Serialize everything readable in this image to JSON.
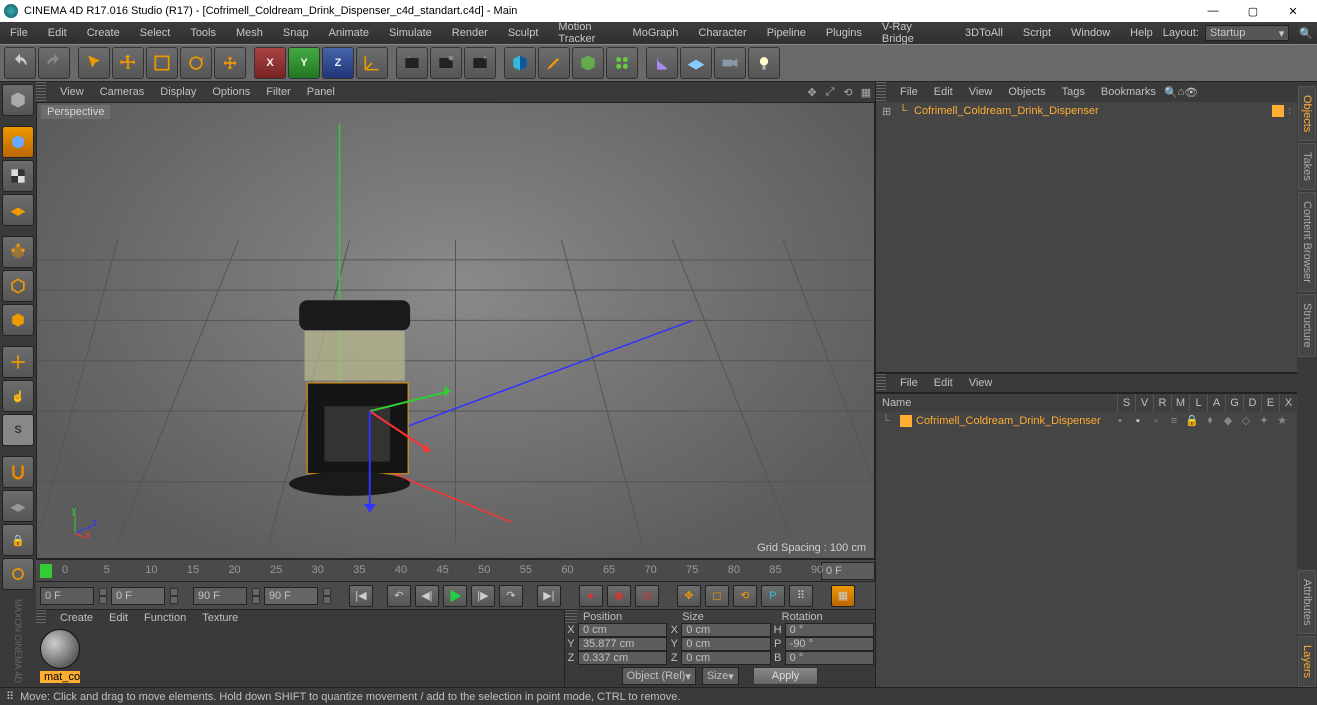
{
  "title": "CINEMA 4D R17.016 Studio (R17) - [Cofrimell_Coldream_Drink_Dispenser_c4d_standart.c4d] - Main",
  "menu": [
    "File",
    "Edit",
    "Create",
    "Select",
    "Tools",
    "Mesh",
    "Snap",
    "Animate",
    "Simulate",
    "Render",
    "Sculpt",
    "Motion Tracker",
    "MoGraph",
    "Character",
    "Pipeline",
    "Plugins",
    "V-Ray Bridge",
    "3DToAll",
    "Script",
    "Window",
    "Help"
  ],
  "layout_label": "Layout:",
  "layout_value": "Startup",
  "viewmenu": [
    "View",
    "Cameras",
    "Display",
    "Options",
    "Filter",
    "Panel"
  ],
  "perspective": "Perspective",
  "grid_spacing": "Grid Spacing : 100 cm",
  "timeline_numbers": [
    "0",
    "5",
    "10",
    "15",
    "20",
    "25",
    "30",
    "35",
    "40",
    "45",
    "50",
    "55",
    "60",
    "65",
    "70",
    "75",
    "80",
    "85",
    "90"
  ],
  "timeline_end": "0 F",
  "play_start": "0 F",
  "play_cur": "0 F",
  "play_end": "90 F",
  "play_end2": "90 F",
  "material_menu": [
    "Create",
    "Edit",
    "Function",
    "Texture"
  ],
  "material_name": "mat_col",
  "coord_hdr": [
    "Position",
    "Size",
    "Rotation"
  ],
  "coord": {
    "x": {
      "pos": "0 cm",
      "size": "0 cm",
      "rot": "0 °",
      "r": "H"
    },
    "y": {
      "pos": "35.877 cm",
      "size": "0 cm",
      "rot": "-90 °",
      "r": "P"
    },
    "z": {
      "pos": "0.337 cm",
      "size": "0 cm",
      "rot": "0 °",
      "r": "B"
    }
  },
  "coord_dd1": "Object (Rel)",
  "coord_dd2": "Size",
  "coord_apply": "Apply",
  "obj_panel_menu": [
    "File",
    "Edit",
    "View",
    "Objects",
    "Tags",
    "Bookmarks"
  ],
  "obj_name": "Cofrimell_Coldream_Drink_Dispenser",
  "tag_panel_menu": [
    "File",
    "Edit",
    "View"
  ],
  "tag_name_col": "Name",
  "tag_cols": [
    "S",
    "V",
    "R",
    "M",
    "L",
    "A",
    "G",
    "D",
    "E",
    "X"
  ],
  "tag_item": "Cofrimell_Coldream_Drink_Dispenser",
  "right_tabs": [
    "Objects",
    "Takes",
    "Content Browser",
    "Structure",
    "Attributes",
    "Layers"
  ],
  "status": "Move: Click and drag to move elements. Hold down SHIFT to quantize movement / add to the selection in point mode, CTRL to remove."
}
